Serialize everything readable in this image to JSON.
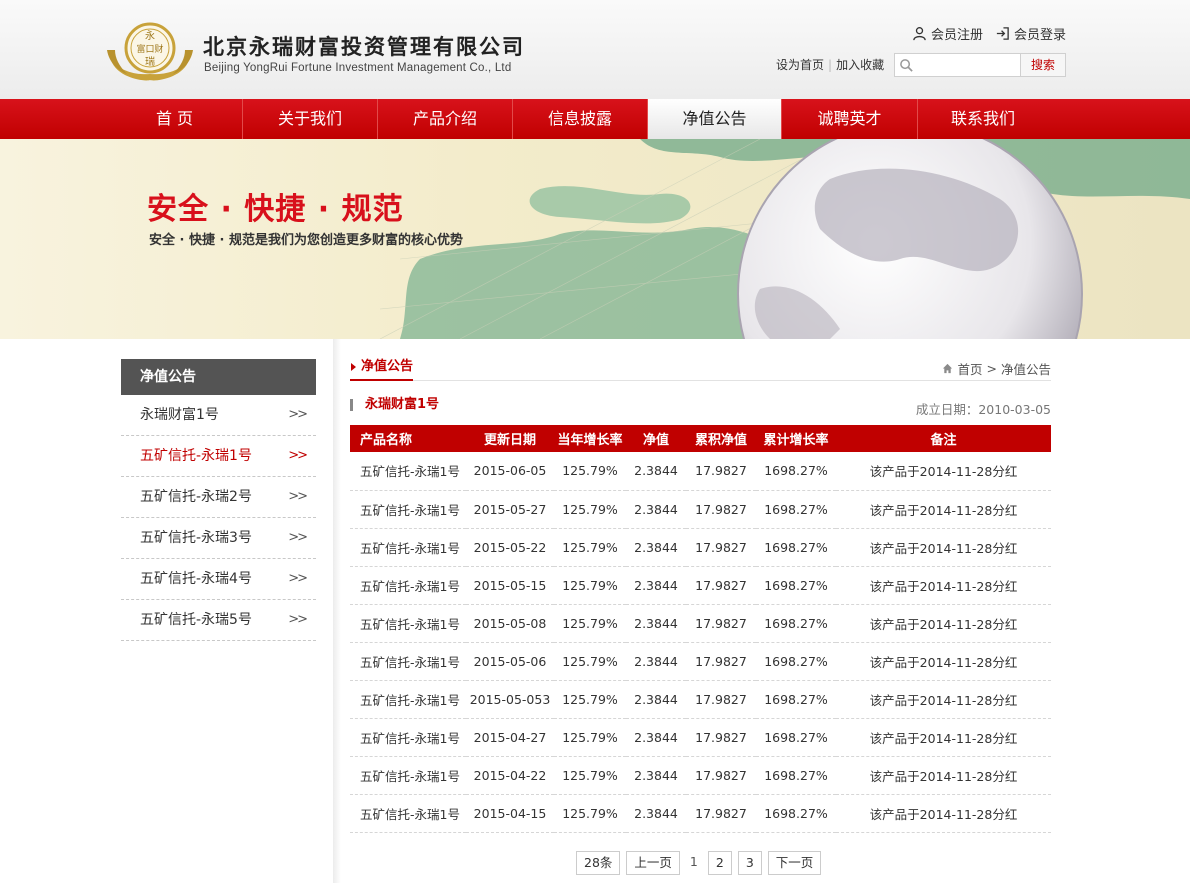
{
  "header": {
    "company_cn": "北京永瑞财富投资管理有限公司",
    "company_en": "Beijing YongRui Fortune Investment Management Co., Ltd",
    "logo_text": [
      "永",
      "富口财",
      "瑞"
    ],
    "member_register": "会员注册",
    "member_login": "会员登录",
    "set_home": "设为首页",
    "add_favorite": "加入收藏",
    "search_placeholder": "",
    "search_button": "搜索"
  },
  "nav": {
    "items": [
      {
        "label": "首 页",
        "width": 136
      },
      {
        "label": "关于我们",
        "width": 135
      },
      {
        "label": "产品介绍",
        "width": 135
      },
      {
        "label": "信息披露",
        "width": 135
      },
      {
        "label": "净值公告",
        "width": 134
      },
      {
        "label": "诚聘英才",
        "width": 136
      },
      {
        "label": "联系我们",
        "width": 130
      }
    ],
    "active_index": 4
  },
  "banner": {
    "title": "安全 · 快捷 · 规范",
    "subtitle": "安全 · 快捷 · 规范是我们为您创造更多财富的核心优势"
  },
  "sidebar": {
    "title": "净值公告",
    "items": [
      {
        "label": "永瑞财富1号",
        "active": false
      },
      {
        "label": "五矿信托-永瑞1号",
        "active": true
      },
      {
        "label": "五矿信托-永瑞2号",
        "active": false
      },
      {
        "label": "五矿信托-永瑞3号",
        "active": false
      },
      {
        "label": "五矿信托-永瑞4号",
        "active": false
      },
      {
        "label": "五矿信托-永瑞5号",
        "active": false
      }
    ],
    "arrow": ">>"
  },
  "main": {
    "section_title": "净值公告",
    "breadcrumb_home": "首页",
    "breadcrumb_sep": ">",
    "breadcrumb_current": "净值公告",
    "product_name": "永瑞财富1号",
    "established": "成立日期：2010-03-05"
  },
  "table": {
    "columns": [
      "产品名称",
      "更新日期",
      "当年增长率",
      "净值",
      "累积净值",
      "累计增长率",
      "备注"
    ],
    "rows": [
      [
        "五矿信托-永瑞1号",
        "2015-06-05",
        "125.79%",
        "2.3844",
        "17.9827",
        "1698.27%",
        "该产品于2014-11-28分红"
      ],
      [
        "五矿信托-永瑞1号",
        "2015-05-27",
        "125.79%",
        "2.3844",
        "17.9827",
        "1698.27%",
        "该产品于2014-11-28分红"
      ],
      [
        "五矿信托-永瑞1号",
        "2015-05-22",
        "125.79%",
        "2.3844",
        "17.9827",
        "1698.27%",
        "该产品于2014-11-28分红"
      ],
      [
        "五矿信托-永瑞1号",
        "2015-05-15",
        "125.79%",
        "2.3844",
        "17.9827",
        "1698.27%",
        "该产品于2014-11-28分红"
      ],
      [
        "五矿信托-永瑞1号",
        "2015-05-08",
        "125.79%",
        "2.3844",
        "17.9827",
        "1698.27%",
        "该产品于2014-11-28分红"
      ],
      [
        "五矿信托-永瑞1号",
        "2015-05-06",
        "125.79%",
        "2.3844",
        "17.9827",
        "1698.27%",
        "该产品于2014-11-28分红"
      ],
      [
        "五矿信托-永瑞1号",
        "2015-05-053",
        "125.79%",
        "2.3844",
        "17.9827",
        "1698.27%",
        "该产品于2014-11-28分红"
      ],
      [
        "五矿信托-永瑞1号",
        "2015-04-27",
        "125.79%",
        "2.3844",
        "17.9827",
        "1698.27%",
        "该产品于2014-11-28分红"
      ],
      [
        "五矿信托-永瑞1号",
        "2015-04-22",
        "125.79%",
        "2.3844",
        "17.9827",
        "1698.27%",
        "该产品于2014-11-28分红"
      ],
      [
        "五矿信托-永瑞1号",
        "2015-04-15",
        "125.79%",
        "2.3844",
        "17.9827",
        "1698.27%",
        "该产品于2014-11-28分红"
      ]
    ]
  },
  "pager": {
    "total": "28条",
    "prev": "上一页",
    "pages": [
      "1",
      "2",
      "3"
    ],
    "current": "1",
    "next": "下一页"
  },
  "colors": {
    "brand_red": "#c00000",
    "nav_active_bg": "#ffffff",
    "sidebar_head_bg": "#545454",
    "logo_gold": "#c8a23a"
  }
}
